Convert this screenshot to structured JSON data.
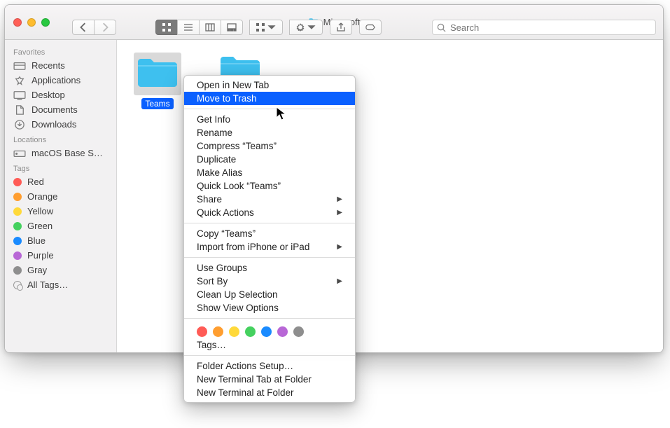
{
  "window_title": "Microsoft",
  "search": {
    "placeholder": "Search"
  },
  "sidebar": {
    "favorites_label": "Favorites",
    "favorites": [
      {
        "label": "Recents"
      },
      {
        "label": "Applications"
      },
      {
        "label": "Desktop"
      },
      {
        "label": "Documents"
      },
      {
        "label": "Downloads"
      }
    ],
    "locations_label": "Locations",
    "locations": [
      {
        "label": "macOS Base S…"
      }
    ],
    "tags_label": "Tags",
    "tags": [
      {
        "label": "Red",
        "color": "#ff5b56"
      },
      {
        "label": "Orange",
        "color": "#ff9e30"
      },
      {
        "label": "Yellow",
        "color": "#ffd93a"
      },
      {
        "label": "Green",
        "color": "#45d15f"
      },
      {
        "label": "Blue",
        "color": "#1a8bff"
      },
      {
        "label": "Purple",
        "color": "#b867d6"
      },
      {
        "label": "Gray",
        "color": "#8e8e8e"
      },
      {
        "label": "All Tags…",
        "color": "all"
      }
    ]
  },
  "folders": [
    {
      "label": "Teams",
      "selected": true
    },
    {
      "label": "",
      "selected": false
    }
  ],
  "context_menu": {
    "sections": [
      [
        {
          "label": "Open in New Tab"
        },
        {
          "label": "Move to Trash",
          "highlight": true
        }
      ],
      [
        {
          "label": "Get Info"
        },
        {
          "label": "Rename"
        },
        {
          "label": "Compress “Teams”"
        },
        {
          "label": "Duplicate"
        },
        {
          "label": "Make Alias"
        },
        {
          "label": "Quick Look “Teams”"
        },
        {
          "label": "Share",
          "submenu": true
        },
        {
          "label": "Quick Actions",
          "submenu": true
        }
      ],
      [
        {
          "label": "Copy “Teams”"
        },
        {
          "label": "Import from iPhone or iPad",
          "submenu": true
        }
      ],
      [
        {
          "label": "Use Groups"
        },
        {
          "label": "Sort By",
          "submenu": true
        },
        {
          "label": "Clean Up Selection"
        },
        {
          "label": "Show View Options"
        }
      ]
    ],
    "tag_colors": [
      "#ff5b56",
      "#ff9e30",
      "#ffd93a",
      "#45d15f",
      "#1a8bff",
      "#b867d6",
      "#8e8e8e"
    ],
    "tags_label": "Tags…",
    "footer": [
      {
        "label": "Folder Actions Setup…"
      },
      {
        "label": "New Terminal Tab at Folder"
      },
      {
        "label": "New Terminal at Folder"
      }
    ]
  }
}
